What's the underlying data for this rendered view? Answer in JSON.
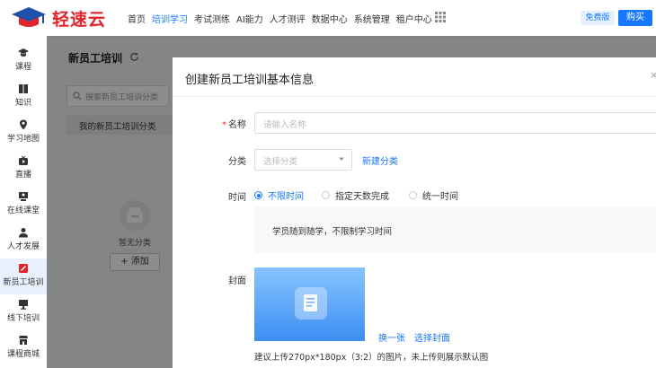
{
  "app": {
    "logo_text": "轻速云"
  },
  "nav": {
    "items": [
      "首页",
      "培训学习",
      "考试测练",
      "AI能力",
      "人才测评",
      "数据中心",
      "系统管理",
      "租户中心"
    ],
    "active_index": 1,
    "free_label": "免费版",
    "buy_label": "购买"
  },
  "sidebar": {
    "items": [
      {
        "label": "课程",
        "icon": "graduation-cap-icon"
      },
      {
        "label": "知识",
        "icon": "book-icon"
      },
      {
        "label": "学习地图",
        "icon": "map-pin-icon"
      },
      {
        "label": "直播",
        "icon": "live-icon"
      },
      {
        "label": "在线课堂",
        "icon": "classroom-icon"
      },
      {
        "label": "人才发展",
        "icon": "talent-icon"
      },
      {
        "label": "新员工培训",
        "icon": "new-employee-icon"
      },
      {
        "label": "线下培训",
        "icon": "offline-icon"
      },
      {
        "label": "课程商城",
        "icon": "store-icon"
      }
    ],
    "active_index": 6
  },
  "content": {
    "title": "新员工培训",
    "search_placeholder": "搜索新员工培训分类",
    "category_item": "我的新员工培训分类",
    "empty_text": "暂无分类",
    "add_label": "+ 添加"
  },
  "modal": {
    "title": "创建新员工培训基本信息",
    "close": "×",
    "name_label": "名称",
    "name_required_mark": "*",
    "name_placeholder": "请输入名称",
    "category_label": "分类",
    "category_placeholder": "选择分类",
    "new_category_link": "新建分类",
    "time_label": "时间",
    "time_options": [
      "不限时间",
      "指定天数完成",
      "统一时间"
    ],
    "time_selected_index": 0,
    "time_description": "学员随到随学，不限制学习时间",
    "cover_label": "封面",
    "change_cover_link": "换一张",
    "select_cover_link": "选择封面",
    "cover_hint": "建议上传270px*180px（3:2）的图片，未上传则展示默认图"
  },
  "colors": {
    "accent": "#1677ff",
    "brand_red": "#e0242b",
    "required": "#f5222d"
  }
}
